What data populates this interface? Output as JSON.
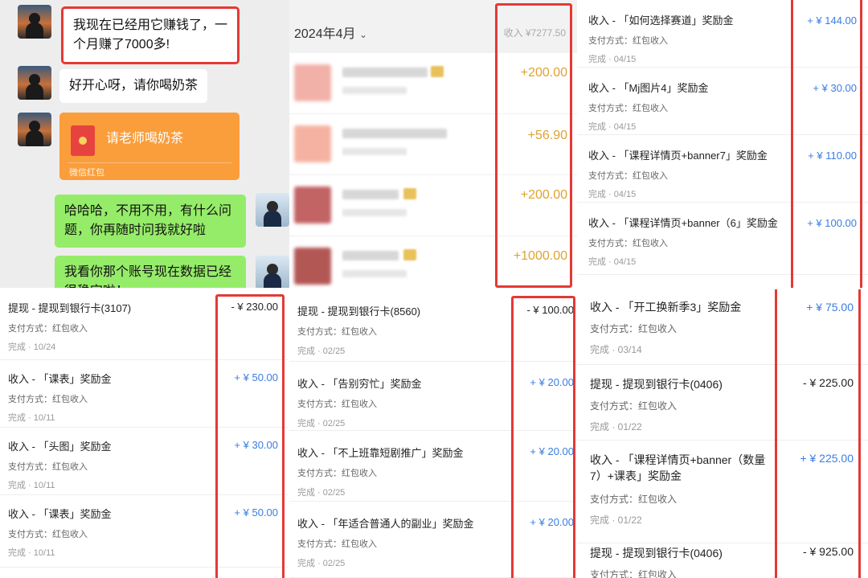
{
  "chat": {
    "messages": [
      {
        "text": "我现在已经用它赚钱了，一个月赚了7000多!"
      },
      {
        "text": "好开心呀，请你喝奶茶"
      },
      {
        "red_packet_title": "请老师喝奶茶",
        "red_packet_footer": "微信红包"
      },
      {
        "text": "哈哈哈，不用不用，有什么问题，你再随时问我就好啦"
      },
      {
        "text": "我看你那个账号现在数据已经很稳定啦！"
      }
    ]
  },
  "bill": {
    "month": "2024年4月",
    "income_label": "收入 ¥7277.50",
    "rows": [
      {
        "amount": "+200.00",
        "thumb_color": "#f0a49a"
      },
      {
        "amount": "+56.90",
        "thumb_color": "#f4a592"
      },
      {
        "amount": "+200.00",
        "thumb_color": "#b8484a"
      },
      {
        "amount": "+1000.00",
        "thumb_color": "#a63a38"
      }
    ]
  },
  "panel_top_right": {
    "items": [
      {
        "title": "收入 - 「如何选择赛道」奖励金",
        "payment": "支付方式：红包收入",
        "status": "完成 · 04/15",
        "amount": "+ ¥ 144.00"
      },
      {
        "title": "收入 - 「Mj图片4」奖励金",
        "payment": "支付方式：红包收入",
        "status": "完成 · 04/15",
        "amount": "+ ¥ 30.00"
      },
      {
        "title": "收入 - 「课程详情页+banner7」奖励金",
        "payment": "支付方式：红包收入",
        "status": "完成 · 04/15",
        "amount": "+ ¥ 110.00"
      },
      {
        "title": "收入 - 「课程详情页+banner（6」奖励金",
        "payment": "支付方式：红包收入",
        "status": "完成 · 04/15",
        "amount": "+ ¥ 100.00"
      }
    ]
  },
  "panel_bottom_left": {
    "items": [
      {
        "title": "提现 - 提现到银行卡(3107)",
        "payment": "支付方式：红包收入",
        "status": "完成 · 10/24",
        "amount": "- ¥ 230.00",
        "sign": "minus"
      },
      {
        "title": "收入 - 「课表」奖励金",
        "payment": "支付方式：红包收入",
        "status": "完成 · 10/11",
        "amount": "+ ¥ 50.00",
        "sign": "plus"
      },
      {
        "title": "收入 - 「头图」奖励金",
        "payment": "支付方式：红包收入",
        "status": "完成 · 10/11",
        "amount": "+ ¥ 30.00",
        "sign": "plus"
      },
      {
        "title": "收入 - 「课表」奖励金",
        "payment": "支付方式：红包收入",
        "status": "完成 · 10/11",
        "amount": "+ ¥ 50.00",
        "sign": "plus"
      }
    ]
  },
  "panel_bottom_middle": {
    "items": [
      {
        "title": "提现 - 提现到银行卡(8560)",
        "payment": "支付方式：红包收入",
        "status": "完成 · 02/25",
        "amount": "- ¥ 100.00",
        "sign": "minus"
      },
      {
        "title": "收入 - 「告别穷忙」奖励金",
        "payment": "支付方式：红包收入",
        "status": "完成 · 02/25",
        "amount": "+ ¥ 20.00",
        "sign": "plus"
      },
      {
        "title": "收入 - 「不上班靠短剧推广」奖励金",
        "payment": "支付方式：红包收入",
        "status": "完成 · 02/25",
        "amount": "+ ¥ 20.00",
        "sign": "plus"
      },
      {
        "title": "收入 - 「年适合普通人的副业」奖励金",
        "payment": "支付方式：红包收入",
        "status": "完成 · 02/25",
        "amount": "+ ¥ 20.00",
        "sign": "plus"
      }
    ]
  },
  "panel_bottom_right": {
    "items": [
      {
        "title": "收入 - 「开工换新季3」奖励金",
        "payment": "支付方式：红包收入",
        "status": "完成 · 03/14",
        "amount": "+ ¥ 75.00",
        "sign": "plus"
      },
      {
        "title": "提现 - 提现到银行卡(0406)",
        "payment": "支付方式：红包收入",
        "status": "完成 · 01/22",
        "amount": "- ¥ 225.00",
        "sign": "minus"
      },
      {
        "title": "收入 - 「课程详情页+banner（数量7）+课表」奖励金",
        "payment": "支付方式：红包收入",
        "status": "完成 · 01/22",
        "amount": "+ ¥ 225.00",
        "sign": "plus"
      },
      {
        "title": "提现 - 提现到银行卡(0406)",
        "payment": "支付方式：红包收入",
        "status": "",
        "amount": "- ¥ 925.00",
        "sign": "minus"
      }
    ]
  }
}
